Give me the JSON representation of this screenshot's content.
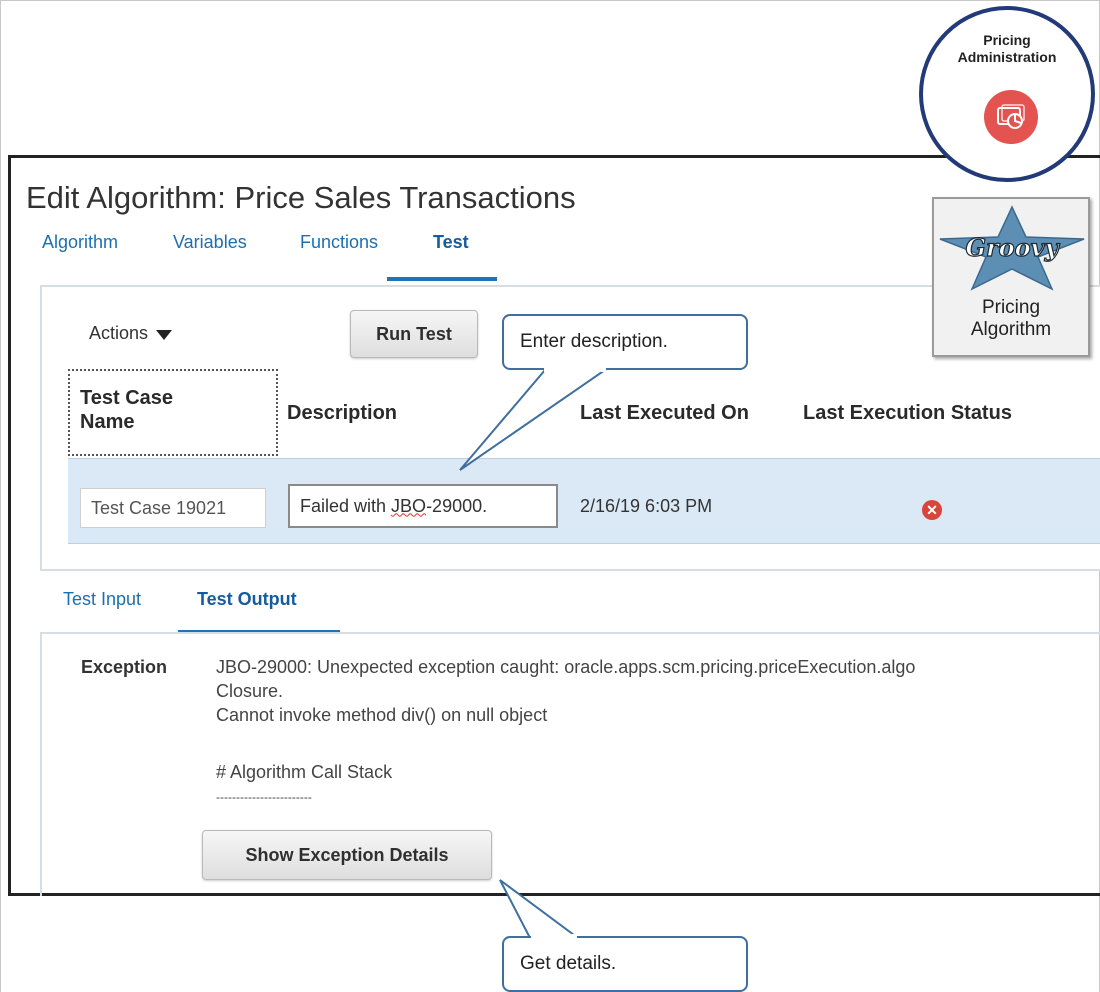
{
  "page": {
    "title": "Edit Algorithm: Price Sales Transactions"
  },
  "tabs": [
    {
      "label": "Algorithm"
    },
    {
      "label": "Variables"
    },
    {
      "label": "Functions"
    },
    {
      "label": "Test",
      "active": true
    }
  ],
  "toolbar": {
    "actions_label": "Actions",
    "run_test_label": "Run Test"
  },
  "table": {
    "columns": [
      "Test Case Name",
      "Description",
      "Last Executed On",
      "Last Execution Status"
    ],
    "column_0_line1": "Test Case",
    "column_0_line2": "Name",
    "rows": [
      {
        "name": "Test Case 19021",
        "description_prefix": "Failed with ",
        "description_flagged": "JBO",
        "description_suffix": "-29000.",
        "last_executed_on": "2/16/19 6:03 PM",
        "status_icon": "error-icon"
      }
    ]
  },
  "subtabs": [
    {
      "label": "Test Input"
    },
    {
      "label": "Test Output",
      "active": true
    }
  ],
  "output": {
    "exception_label": "Exception",
    "lines": [
      "JBO-29000: Unexpected exception caught: oracle.apps.scm.pricing.priceExecution.algo",
      "Closure.",
      "Cannot invoke method div() on null object",
      "# Algorithm Call Stack",
      "------------------------"
    ],
    "show_details_label": "Show Exception Details"
  },
  "callouts": {
    "enter_description": "Enter description.",
    "get_details": "Get details."
  },
  "badges": {
    "pricing_admin_line1": "Pricing",
    "pricing_admin_line2": "Administration",
    "pricing_algorithm_line1": "Pricing",
    "pricing_algorithm_line2": "Algorithm",
    "groovy_logo_text": "Groovy"
  },
  "colors": {
    "link_blue": "#1c6fb0",
    "row_highlight": "#dbe9f6",
    "error_red": "#d9453b",
    "callout_border": "#3f6f9e",
    "badge_ring": "#223a78"
  }
}
